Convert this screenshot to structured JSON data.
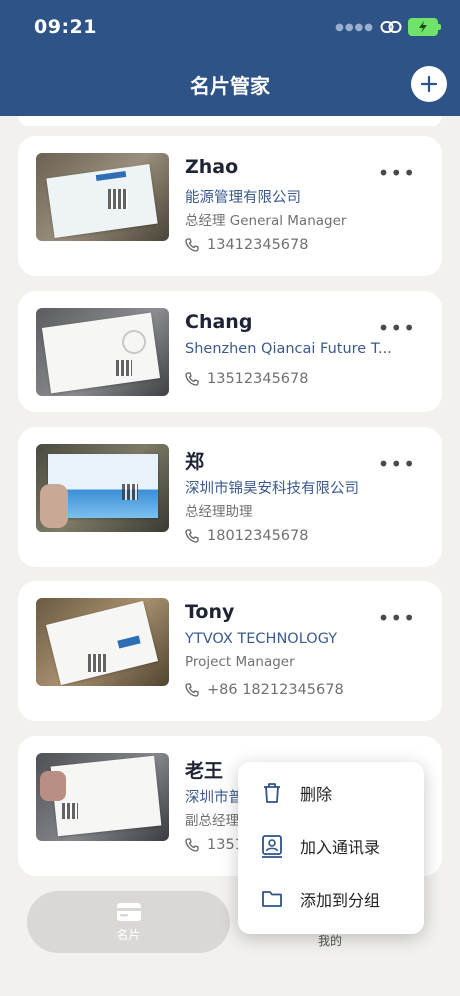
{
  "status_bar": {
    "time": "09:21"
  },
  "header": {
    "title": "名片管家"
  },
  "contacts": [
    {
      "name": "Zhao",
      "company": "能源管理有限公司",
      "title": "总经理 General Manager",
      "phone": "13412345678"
    },
    {
      "name": "Chang",
      "company": "Shenzhen Qiancai Future T...",
      "phone": "13512345678"
    },
    {
      "name": "郑",
      "company": "深圳市锦昊安科技有限公司",
      "title": "总经理助理",
      "phone": "18012345678"
    },
    {
      "name": "Tony",
      "company": "YTVOX TECHNOLOGY",
      "title": "Project Manager",
      "phone": "+86 18212345678"
    },
    {
      "name": "老王",
      "company": "深圳市普",
      "title": "副总经理",
      "phone": "1351"
    }
  ],
  "context_menu": {
    "items": [
      {
        "label": "删除",
        "icon": "trash-icon"
      },
      {
        "label": "加入通讯录",
        "icon": "contact-book-icon"
      },
      {
        "label": "添加到分组",
        "icon": "folder-icon"
      }
    ]
  },
  "tabs": [
    {
      "label": "名片",
      "icon": "card-icon",
      "active": true
    },
    {
      "label": "我的",
      "active": false
    }
  ],
  "colors": {
    "header": "#2e5387",
    "accent_text": "#3a5a8c",
    "background": "#f2f1ee"
  }
}
